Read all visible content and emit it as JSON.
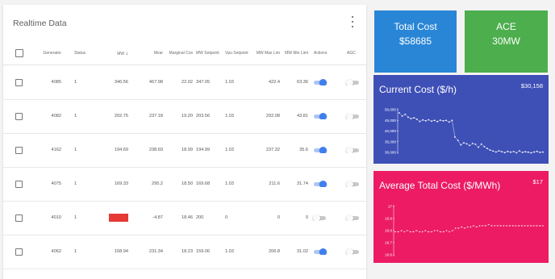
{
  "table": {
    "title": "Realtime Data",
    "more_icon": "more-vert-icon",
    "sort_icon": "↓",
    "columns": {
      "generator": "Generator",
      "status": "Status",
      "mw": "MW",
      "mvar": "Mvar",
      "marginal_cost": "Marginal Cos",
      "mw_setpoint": "MW Setpoint",
      "vpu_setpoint": "Vpu Setpoint",
      "mw_max": "MW Max Lim",
      "mw_min": "MW Min Limi",
      "actions": "Actions",
      "agc": "AGC"
    },
    "rows": [
      {
        "generator": "4085",
        "status": "1",
        "mw": "346.56",
        "mvar": "467.98",
        "marginal_cost": "22.02",
        "mw_setpoint": "347.05",
        "vpu_setpoint": "1.03",
        "mw_max": "422.4",
        "mw_min": "63.36",
        "actions_on": true,
        "agc_on": false,
        "mw_alert": false
      },
      {
        "generator": "4082",
        "status": "1",
        "mw": "202.75",
        "mvar": "237.18",
        "marginal_cost": "19.20",
        "mw_setpoint": "203.56",
        "vpu_setpoint": "1.03",
        "mw_max": "292.08",
        "mw_min": "43.81",
        "actions_on": true,
        "agc_on": false,
        "mw_alert": false
      },
      {
        "generator": "4162",
        "status": "1",
        "mw": "194.69",
        "mvar": "238.69",
        "marginal_cost": "18.99",
        "mw_setpoint": "194.99",
        "vpu_setpoint": "1.03",
        "mw_max": "237.32",
        "mw_min": "35.6",
        "actions_on": true,
        "agc_on": false,
        "mw_alert": false
      },
      {
        "generator": "4075",
        "status": "1",
        "mw": "169.33",
        "mvar": "295.2",
        "marginal_cost": "18.50",
        "mw_setpoint": "169.68",
        "vpu_setpoint": "1.03",
        "mw_max": "211.6",
        "mw_min": "31.74",
        "actions_on": true,
        "agc_on": false,
        "mw_alert": false
      },
      {
        "generator": "4010",
        "status": "1",
        "mw": "",
        "mvar": "-4.87",
        "marginal_cost": "18.46",
        "mw_setpoint": "200",
        "vpu_setpoint": "0",
        "mw_max": "0",
        "mw_min": "0",
        "actions_on": false,
        "agc_on": false,
        "mw_alert": true
      },
      {
        "generator": "4062",
        "status": "1",
        "mw": "158.94",
        "mvar": "231.34",
        "marginal_cost": "18.23",
        "mw_setpoint": "159.06",
        "vpu_setpoint": "1.03",
        "mw_max": "206.8",
        "mw_min": "31.02",
        "actions_on": true,
        "agc_on": false,
        "mw_alert": false
      }
    ]
  },
  "stats": {
    "total_cost_label": "Total Cost",
    "total_cost_value": "$58685",
    "ace_label": "ACE",
    "ace_value": "30MW",
    "total_cost_color": "#2986d6",
    "ace_color": "#4cae4c"
  },
  "chart_data": [
    {
      "type": "line",
      "title": "Current Cost ($/h)",
      "headline": "$30,158",
      "y_ticks": [
        "50,000",
        "45,000",
        "40,000",
        "35,000",
        "30,000"
      ],
      "ylim": [
        30000,
        50000
      ],
      "background": "#3e4fb6",
      "values": [
        48500,
        47000,
        47800,
        46500,
        45800,
        46200,
        45500,
        44500,
        45200,
        44800,
        45300,
        44600,
        45000,
        44400,
        45100,
        44700,
        45000,
        44200,
        45000,
        37200,
        35600,
        33500,
        34500,
        34000,
        33200,
        34200,
        33800,
        32400,
        33900,
        32700,
        31800,
        31100,
        30600,
        30200,
        30700,
        30300,
        29900,
        30500,
        30100,
        30400,
        29800,
        30700,
        30000,
        30300,
        30100,
        29800,
        30200,
        30500,
        30000,
        30158
      ]
    },
    {
      "type": "line",
      "title": "Average Total Cost ($/MWh)",
      "headline": "$17",
      "y_ticks": [
        "17",
        "16.9",
        "16.8",
        "16.7",
        "16.6"
      ],
      "ylim": [
        16.6,
        17
      ],
      "background": "#ec1b63",
      "values": [
        16.79,
        16.79,
        16.8,
        16.79,
        16.8,
        16.79,
        16.79,
        16.8,
        16.79,
        16.79,
        16.8,
        16.79,
        16.79,
        16.8,
        16.8,
        16.79,
        16.79,
        16.8,
        16.79,
        16.8,
        16.82,
        16.82,
        16.83,
        16.82,
        16.83,
        16.83,
        16.84,
        16.83,
        16.84,
        16.84,
        16.84,
        16.85,
        16.84,
        16.84,
        16.84,
        16.84,
        16.84,
        16.84,
        16.84,
        16.84,
        16.84,
        16.84,
        16.84,
        16.84,
        16.84,
        16.84,
        16.84,
        16.84,
        16.84,
        16.84
      ]
    }
  ]
}
